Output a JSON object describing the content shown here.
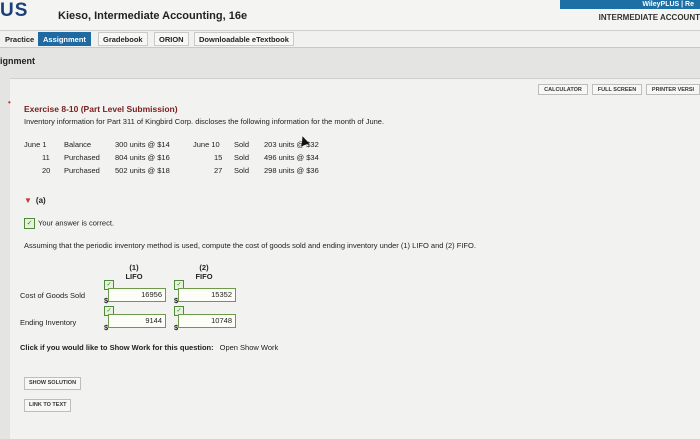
{
  "header": {
    "logo_fragment": "US",
    "book_title": "Kieso, Intermediate Accounting, 16e",
    "top_nav": "WileyPLUS | Re",
    "course_title": "INTERMEDIATE ACCOUNT"
  },
  "tabs": [
    "Practice",
    "Assignment",
    "Gradebook",
    "ORION",
    "Downloadable eTextbook"
  ],
  "section_label": "ignment",
  "toolbar": {
    "calculator": "CALCULATOR",
    "full_screen": "FULL SCREEN",
    "printer": "PRINTER VERSI"
  },
  "exercise": {
    "title": "Exercise 8-10 (Part Level Submission)",
    "description": "Inventory information for Part 311 of Kingbird Corp. discloses the following information for the month of June.",
    "purchases": [
      {
        "date": "June 1",
        "desc": "Balance",
        "detail": "300 units @ $14"
      },
      {
        "date": "11",
        "desc": "Purchased",
        "detail": "804 units @ $16"
      },
      {
        "date": "20",
        "desc": "Purchased",
        "detail": "502 units @ $18"
      }
    ],
    "sales": [
      {
        "date": "June 10",
        "desc": "Sold",
        "detail": "203 units @ $32"
      },
      {
        "date": "15",
        "desc": "Sold",
        "detail": "496 units @ $34"
      },
      {
        "date": "27",
        "desc": "Sold",
        "detail": "298 units @ $36"
      }
    ]
  },
  "part_a": {
    "label": "(a)",
    "status": "Your answer is correct.",
    "question": "Assuming that the periodic inventory method is used, compute the cost of goods sold and ending inventory under (1) LIFO and (2) FIFO.",
    "columns": [
      {
        "num": "(1)",
        "name": "LIFO"
      },
      {
        "num": "(2)",
        "name": "FIFO"
      }
    ],
    "rows": [
      {
        "label": "Cost of Goods Sold",
        "lifo": "16956",
        "fifo": "15352"
      },
      {
        "label": "Ending Inventory",
        "lifo": "9144",
        "fifo": "10748"
      }
    ],
    "currency": "$",
    "check_glyph": "✓"
  },
  "show_work": {
    "prompt": "Click if you would like to Show Work for this question:",
    "link": "Open Show Work"
  },
  "buttons": {
    "solution": "SHOW SOLUTION",
    "link_text": "LINK TO TEXT"
  }
}
